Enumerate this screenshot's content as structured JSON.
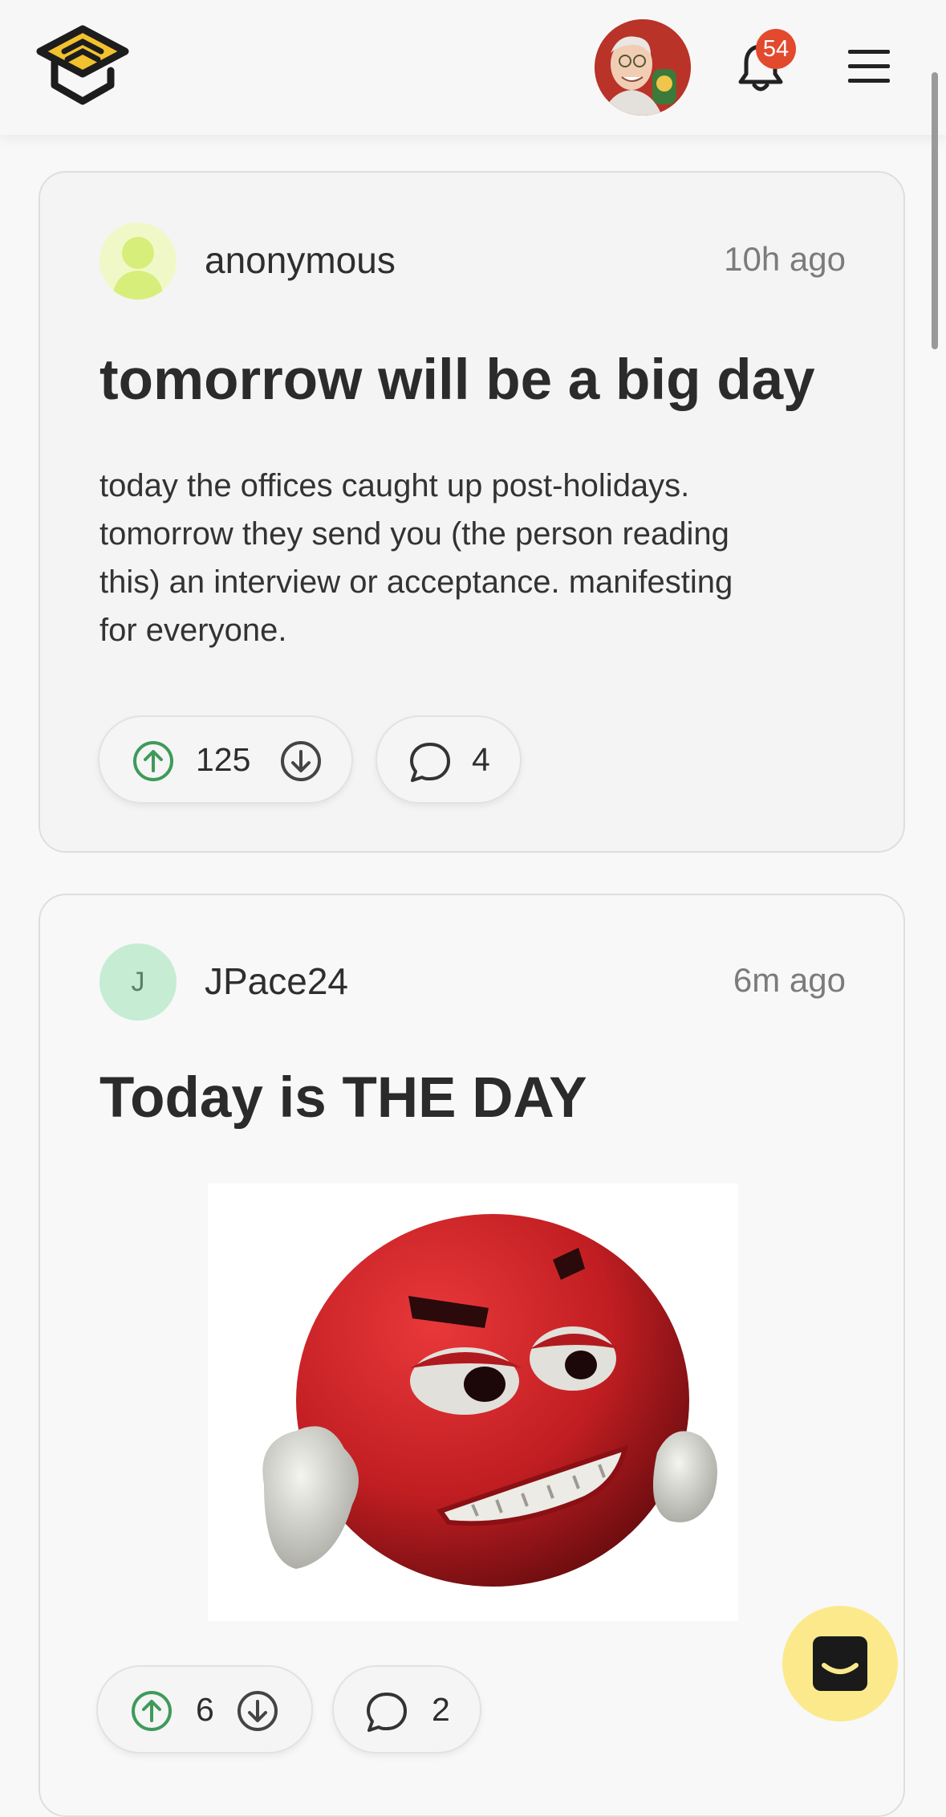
{
  "header": {
    "logo_icon": "graduation-cap-logo",
    "notification_count": "54",
    "colors": {
      "badge": "#e2492d",
      "logo_yellow": "#f2c12e"
    }
  },
  "posts": [
    {
      "author": "anonymous",
      "avatar_icon": "person-silhouette-icon",
      "time": "10h ago",
      "title": "tomorrow will be a big day",
      "body": [
        "today the offices caught up post-holidays.",
        "tomorrow they send you (the person reading",
        "this) an interview or acceptance. manifesting",
        "for everyone."
      ],
      "votes": "125",
      "comments": "4"
    },
    {
      "author": "JPace24",
      "avatar_initial": "J",
      "time": "6m ago",
      "title": "Today is THE DAY",
      "image": "angry-red-emoji-with-fists",
      "votes": "6",
      "comments": "2"
    }
  ],
  "colors": {
    "upvote": "#3f9a5b",
    "fab": "#fbe98c",
    "initial_avatar": "#c6ecd3"
  }
}
